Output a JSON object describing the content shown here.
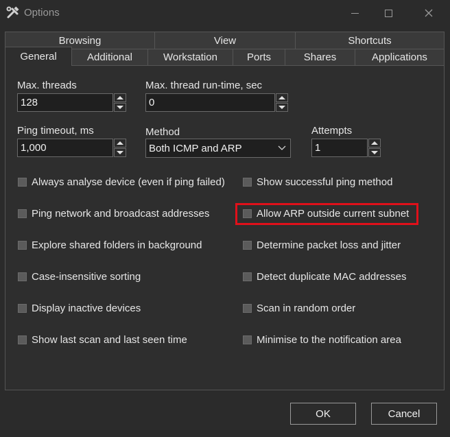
{
  "window": {
    "title": "Options",
    "app_icon": "tools-icon",
    "minimize_icon": "minimize-icon",
    "maximize_icon": "maximize-icon",
    "close_icon": "close-icon"
  },
  "tabs": {
    "row1": [
      "Browsing",
      "View",
      "Shortcuts"
    ],
    "row2": [
      "General",
      "Additional",
      "Workstation",
      "Ports",
      "Shares",
      "Applications"
    ],
    "active": "General"
  },
  "fields": {
    "max_threads": {
      "label": "Max. threads",
      "value": "128"
    },
    "max_runtime": {
      "label": "Max. thread run-time, sec",
      "value": "0"
    },
    "ping_timeout": {
      "label": "Ping timeout, ms",
      "value": "1,000"
    },
    "method": {
      "label": "Method",
      "value": "Both ICMP and ARP"
    },
    "attempts": {
      "label": "Attempts",
      "value": "1"
    }
  },
  "checkboxes": {
    "left": [
      "Always analyse device (even if ping failed)",
      "Ping network and broadcast addresses",
      "Explore shared folders in background",
      "Case-insensitive sorting",
      "Display inactive devices",
      "Show last scan and last seen time"
    ],
    "right": [
      "Show successful ping method",
      "Allow ARP outside current subnet",
      "Determine packet loss and jitter",
      "Detect duplicate MAC addresses",
      "Scan in random order",
      "Minimise to the notification area"
    ]
  },
  "highlight": {
    "target": "Allow ARP outside current subnet",
    "color": "#e0101a"
  },
  "buttons": {
    "ok": "OK",
    "cancel": "Cancel"
  }
}
